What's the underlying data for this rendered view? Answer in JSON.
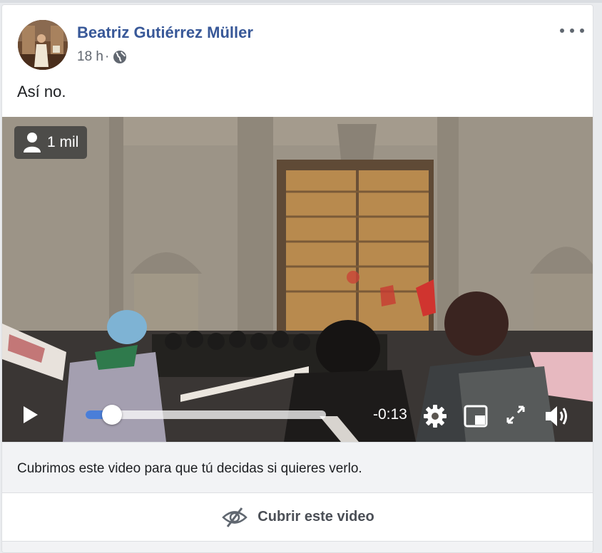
{
  "post": {
    "author": "Beatriz Gutiérrez Müller",
    "timestamp": "18 h",
    "separator": "·",
    "privacy_icon": "globe-icon",
    "more_icon": "more-options-icon",
    "text": "Así no."
  },
  "video": {
    "viewers_count": "1 mil",
    "viewers_icon": "person-icon",
    "time_remaining": "-0:13",
    "progress": 0.11,
    "controls_icons": [
      "play-icon",
      "settings-icon",
      "picture-in-picture-icon",
      "fullscreen-icon",
      "volume-icon"
    ]
  },
  "notice": {
    "text": "Cubrimos este video para que tú decidas si quieres verlo."
  },
  "cover_button": {
    "label": "Cubrir este video",
    "icon": "eye-slash-icon"
  },
  "colors": {
    "author": "#385898",
    "progress": "#4a7ed8",
    "page_bg": "#e9ebee"
  }
}
